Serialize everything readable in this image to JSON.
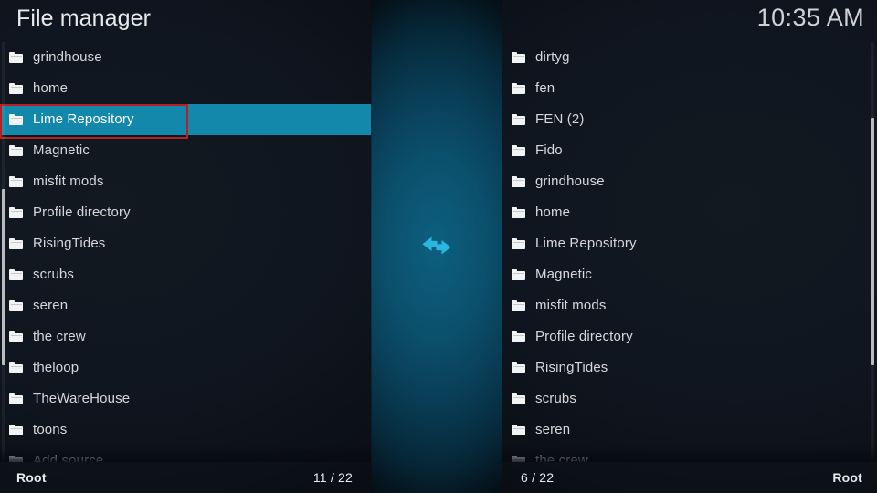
{
  "header": {
    "title": "File manager",
    "clock": "10:35 AM"
  },
  "colors": {
    "selection": "#1388ab",
    "focus_border": "#b81f22",
    "center_accent": "#29b6e0",
    "text": "#d6d8da",
    "background": "#0d1014"
  },
  "center": {
    "swap_icon": "left-right-arrows-icon"
  },
  "left_panel": {
    "items": [
      {
        "name": "grindhouse",
        "icon": "folder-icon",
        "selected": false
      },
      {
        "name": "home",
        "icon": "folder-icon",
        "selected": false
      },
      {
        "name": "Lime Repository",
        "icon": "folder-icon",
        "selected": true
      },
      {
        "name": "Magnetic",
        "icon": "folder-icon",
        "selected": false
      },
      {
        "name": "misfit mods",
        "icon": "folder-icon",
        "selected": false
      },
      {
        "name": "Profile directory",
        "icon": "folder-icon",
        "selected": false
      },
      {
        "name": "RisingTides",
        "icon": "folder-icon",
        "selected": false
      },
      {
        "name": "scrubs",
        "icon": "folder-icon",
        "selected": false
      },
      {
        "name": "seren",
        "icon": "folder-icon",
        "selected": false
      },
      {
        "name": "the crew",
        "icon": "folder-icon",
        "selected": false
      },
      {
        "name": "theloop",
        "icon": "folder-icon",
        "selected": false
      },
      {
        "name": "TheWareHouse",
        "icon": "folder-icon",
        "selected": false
      },
      {
        "name": "toons",
        "icon": "folder-icon",
        "selected": false
      },
      {
        "name": "Add source",
        "icon": "folder-icon",
        "selected": false
      }
    ],
    "status": {
      "location": "Root",
      "counter": "11 / 22"
    },
    "scroll": {
      "thumb_top_pct": 35,
      "thumb_height_pct": 42
    }
  },
  "right_panel": {
    "items": [
      {
        "name": "dirtyg",
        "icon": "folder-icon",
        "selected": false
      },
      {
        "name": "fen",
        "icon": "folder-icon",
        "selected": false
      },
      {
        "name": "FEN (2)",
        "icon": "folder-icon",
        "selected": false
      },
      {
        "name": "Fido",
        "icon": "folder-icon",
        "selected": false
      },
      {
        "name": "grindhouse",
        "icon": "folder-icon",
        "selected": false
      },
      {
        "name": "home",
        "icon": "folder-icon",
        "selected": false
      },
      {
        "name": "Lime Repository",
        "icon": "folder-icon",
        "selected": false
      },
      {
        "name": "Magnetic",
        "icon": "folder-icon",
        "selected": false
      },
      {
        "name": "misfit mods",
        "icon": "folder-icon",
        "selected": false
      },
      {
        "name": "Profile directory",
        "icon": "folder-icon",
        "selected": false
      },
      {
        "name": "RisingTides",
        "icon": "folder-icon",
        "selected": false
      },
      {
        "name": "scrubs",
        "icon": "folder-icon",
        "selected": false
      },
      {
        "name": "seren",
        "icon": "folder-icon",
        "selected": false
      },
      {
        "name": "the crew",
        "icon": "folder-icon",
        "selected": false
      }
    ],
    "status": {
      "counter": "6 / 22",
      "location": "Root"
    },
    "scroll": {
      "thumb_top_pct": 18,
      "thumb_height_pct": 59
    }
  }
}
